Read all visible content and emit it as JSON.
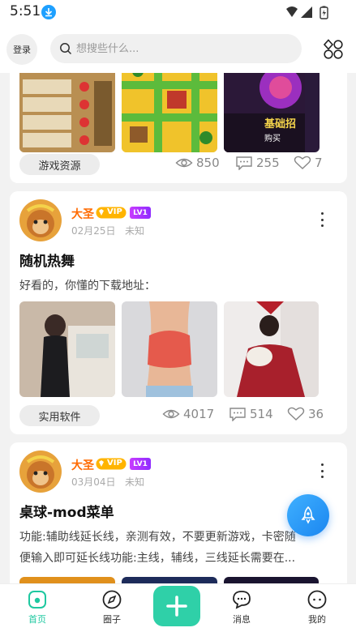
{
  "status_bar": {
    "time": "5:51"
  },
  "top_bar": {
    "login_label": "登录",
    "search_placeholder": "想搜些什么..."
  },
  "posts": [
    {
      "tag": "游戏资源",
      "views": "850",
      "comments": "255",
      "likes": "7",
      "thumb_caption": "基础招",
      "thumb_caption_small": "购买"
    },
    {
      "author": "大圣",
      "vip_label": "VIP",
      "level_label": "LV1",
      "date": "02月25日",
      "location": "未知",
      "title": "随机热舞",
      "body": "好看的，你懂的下载地址：",
      "tag": "实用软件",
      "views": "4017",
      "comments": "514",
      "likes": "36"
    },
    {
      "author": "大圣",
      "vip_label": "VIP",
      "level_label": "LV1",
      "date": "03月04日",
      "location": "未知",
      "title": "桌球-mod菜单",
      "body_line1": "功能:辅助线延长线，亲测有效，不要更新游戏，卡密随",
      "body_line2": "便输入即可延长线功能:主线，辅线，三线延长需要在..."
    }
  ],
  "bottom_nav": {
    "items": [
      {
        "label": "首页",
        "icon": "home-icon",
        "active": true
      },
      {
        "label": "圈子",
        "icon": "compass-icon",
        "active": false
      },
      {
        "label": "消息",
        "icon": "message-icon",
        "active": false
      },
      {
        "label": "我的",
        "icon": "profile-icon",
        "active": false
      }
    ]
  },
  "colors": {
    "accent": "#2fd0a8",
    "author": "#ff6a00",
    "fab": "#1b86f0",
    "level_badge": "#a33cff"
  }
}
